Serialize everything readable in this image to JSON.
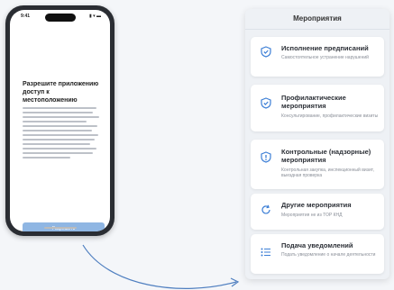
{
  "phone": {
    "status_time": "9:41",
    "status_icons": "▮ ▾ ▬",
    "dialog_title": "Разрешите приложению доступ к местоположению",
    "allow_button": "Разрешить"
  },
  "panel": {
    "title": "Мероприятия",
    "items": [
      {
        "title": "Исполнение предписаний",
        "subtitle": "Самостоятельное устранение нарушений",
        "icon": "shield-check-icon"
      },
      {
        "title": "Профилактические мероприятия",
        "subtitle": "Консультирование, профилактические визиты",
        "icon": "shield-check-icon"
      },
      {
        "title": "Контрольные (надзорные) мероприятия",
        "subtitle": "Контрольная закупка, инспекционный визит, выездная проверка",
        "icon": "shield-alert-icon"
      },
      {
        "title": "Другие мероприятия",
        "subtitle": "Мероприятия не из ТОР КНД",
        "icon": "refresh-icon"
      },
      {
        "title": "Подача уведомлений",
        "subtitle": "Подать уведомление о начале деятельности",
        "icon": "list-icon"
      }
    ]
  },
  "colors": {
    "accent": "#3d7fd6",
    "button": "#8fb6e3",
    "panel_bg": "#eef1f5"
  }
}
